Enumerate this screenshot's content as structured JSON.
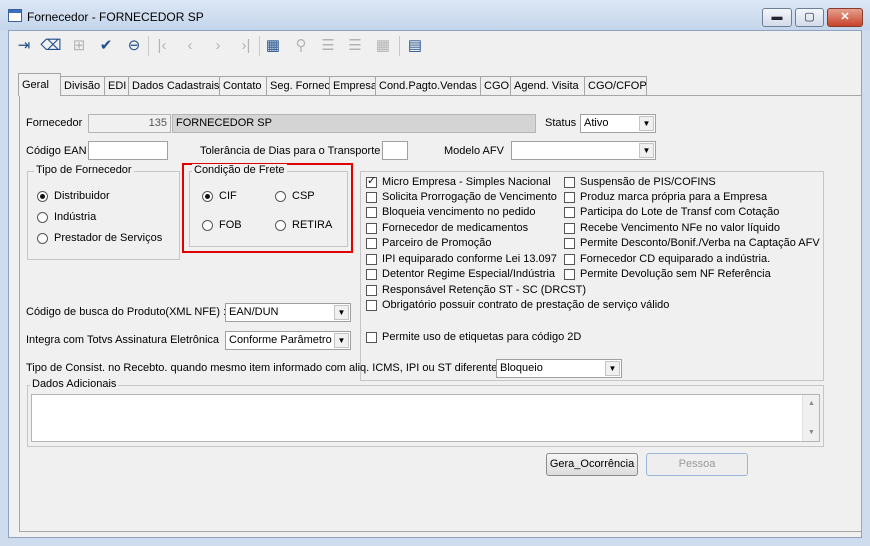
{
  "window": {
    "title": "Fornecedor - FORNECEDOR SP",
    "minimize": "▬",
    "maximize": "▢",
    "close": "✕"
  },
  "toolbar": [
    {
      "name": "exit-icon",
      "glyph": "⇥",
      "disabled": false
    },
    {
      "name": "eraser-icon",
      "glyph": "⌫",
      "disabled": false
    },
    {
      "name": "new-record-icon",
      "glyph": "⊞",
      "disabled": true
    },
    {
      "name": "save-record-icon",
      "glyph": "✔",
      "disabled": false
    },
    {
      "name": "delete-record-icon",
      "glyph": "⊖",
      "disabled": false
    },
    {
      "name": "first-record-icon",
      "glyph": "|‹",
      "disabled": true
    },
    {
      "name": "previous-record-icon",
      "glyph": "‹",
      "disabled": true
    },
    {
      "name": "next-record-icon",
      "glyph": "›",
      "disabled": true
    },
    {
      "name": "last-record-icon",
      "glyph": "›|",
      "disabled": true
    },
    {
      "name": "table-view-icon",
      "glyph": "▦",
      "disabled": false
    },
    {
      "name": "search-icon",
      "glyph": "⚲",
      "disabled": true
    },
    {
      "name": "add-row-icon",
      "glyph": "☰",
      "disabled": true
    },
    {
      "name": "remove-row-icon",
      "glyph": "☰",
      "disabled": true
    },
    {
      "name": "grid-icon",
      "glyph": "▦",
      "disabled": true
    },
    {
      "name": "list-icon",
      "glyph": "▤",
      "disabled": false
    }
  ],
  "tabs": [
    "Geral",
    "Divisão",
    "EDI",
    "Dados Cadastrais",
    "Contato",
    "Seg. Fornec",
    "Empresa",
    "Cond.Pagto.Vendas",
    "CGO",
    "Agend. Visita",
    "CGO/CFOP"
  ],
  "form": {
    "fornecedor_label": "Fornecedor",
    "fornecedor_code": "135",
    "fornecedor_name": "FORNECEDOR SP",
    "status_label": "Status",
    "status_value": "Ativo",
    "ean_label": "Código EAN",
    "ean_value": "",
    "tolerancia_label": "Tolerância de Dias para o Transporte",
    "tolerancia_value": "",
    "modelo_afv_label": "Modelo AFV",
    "modelo_afv_value": "",
    "tipo_title": "Tipo de Fornecedor",
    "tipo_options": [
      {
        "label": "Distribuidor",
        "selected": true
      },
      {
        "label": "Indústria",
        "selected": false
      },
      {
        "label": "Prestador de Serviços",
        "selected": false
      }
    ],
    "frete_title": "Condição de Frete",
    "frete_options": [
      {
        "label": "CIF",
        "selected": true
      },
      {
        "label": "CSP",
        "selected": false
      },
      {
        "label": "FOB",
        "selected": false
      },
      {
        "label": "RETIRA",
        "selected": false
      }
    ],
    "checks_left": [
      {
        "label": "Micro Empresa - Simples Nacional",
        "checked": true
      },
      {
        "label": "Solicita Prorrogação de Vencimento",
        "checked": false
      },
      {
        "label": "Bloqueia vencimento no pedido",
        "checked": false
      },
      {
        "label": "Fornecedor de medicamentos",
        "checked": false
      },
      {
        "label": "Parceiro de Promoção",
        "checked": false
      },
      {
        "label": "IPI equiparado conforme Lei 13.097",
        "checked": false
      },
      {
        "label": "Detentor Regime Especial/Indústria",
        "checked": false
      },
      {
        "label": "Responsável Retenção ST - SC (DRCST)",
        "checked": false
      },
      {
        "label": "Obrigatório possuir contrato de prestação de serviço válido",
        "checked": false
      }
    ],
    "checks_right": [
      {
        "label": "Suspensão de PIS/COFINS",
        "checked": false
      },
      {
        "label": "Produz marca própria para a Empresa",
        "checked": false
      },
      {
        "label": "Participa do Lote de Transf com Cotação",
        "checked": false
      },
      {
        "label": "Recebe Vencimento NFe no valor líquido",
        "checked": false
      },
      {
        "label": "Permite Desconto/Bonif./Verba na Captação AFV",
        "checked": false
      },
      {
        "label": "Fornecedor CD equiparado a indústria.",
        "checked": false
      },
      {
        "label": "Permite Devolução sem NF Referência",
        "checked": false
      }
    ],
    "etiquetas_label": "Permite uso de etiquetas para código 2D",
    "etiquetas_checked": false,
    "busca_label": "Código de busca do Produto(XML NFE) :",
    "busca_value": "EAN/DUN",
    "integra_label": "Integra com Totvs Assinatura Eletrônica",
    "integra_value": "Conforme Parâmetro",
    "consist_label": "Tipo de Consist. no Recebto. quando mesmo item informado com aliq. ICMS, IPI ou ST diferentes:",
    "consist_value": "Bloqueio",
    "dados_title": "Dados Adicionais",
    "dados_value": "",
    "gera_button": "Gera_Ocorrência",
    "pessoa_button": "Pessoa"
  }
}
